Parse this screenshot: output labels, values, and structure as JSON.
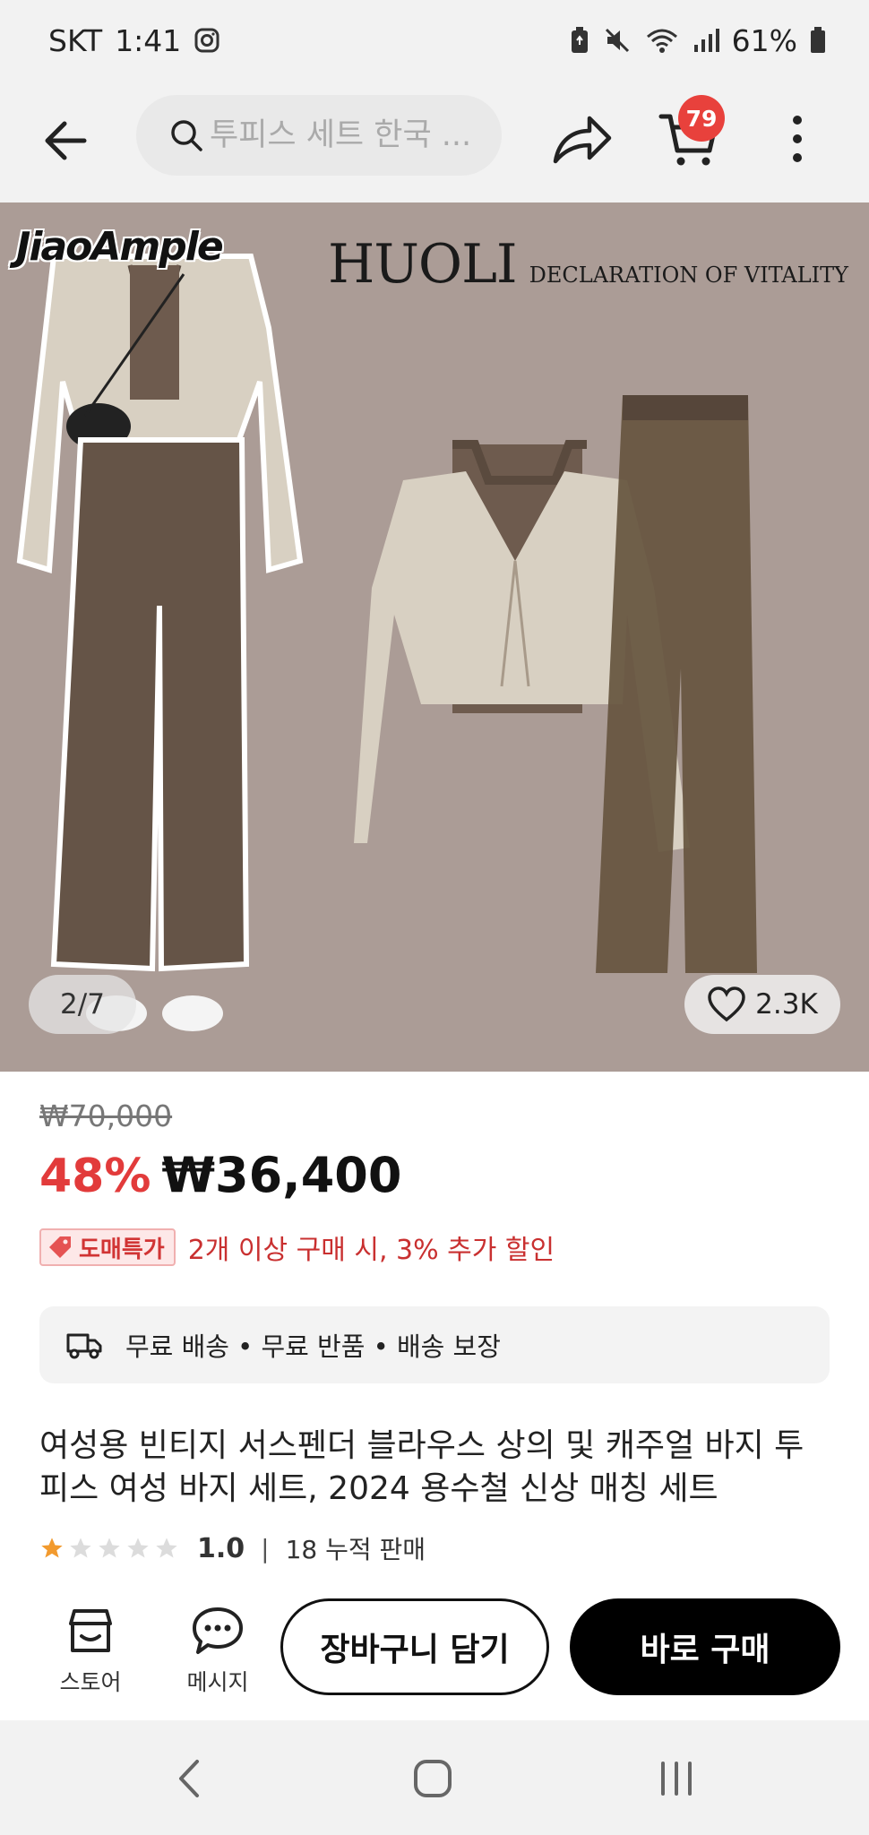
{
  "status_bar": {
    "carrier": "SKT",
    "time": "1:41",
    "battery": "61%"
  },
  "header": {
    "search_placeholder": "투피스 세트 한국 ...",
    "cart_count": "79"
  },
  "gallery": {
    "watermark_left": "JiaoAmple",
    "brand": "HUOLI",
    "brand_tagline": "DECLARATION OF VITALITY",
    "counter": "2/7",
    "likes": "2.3K"
  },
  "pricing": {
    "original_price": "₩70,000",
    "discount": "48%",
    "price": "₩36,400",
    "promo_tag": "도매특가",
    "promo_text": "2개 이상 구매 시, 3% 추가 할인"
  },
  "shipping": {
    "text": "무료 배송 • 무료 반품 • 배송 보장"
  },
  "product": {
    "title": "여성용 빈티지 서스펜더 블라우스 상의 및 캐주얼 바지 투피스 여성 바지 세트, 2024 용수철 신상 매칭 세트",
    "rating": "1.0",
    "rating_stars": 1,
    "sales": "18 누적 판매"
  },
  "actions": {
    "store_label": "스토어",
    "message_label": "메시지",
    "add_to_cart": "장바구니 담기",
    "buy_now": "바로 구매"
  },
  "colors": {
    "accent_red": "#e23b3b",
    "badge": "#e8413c",
    "star": "#f29a2e"
  }
}
